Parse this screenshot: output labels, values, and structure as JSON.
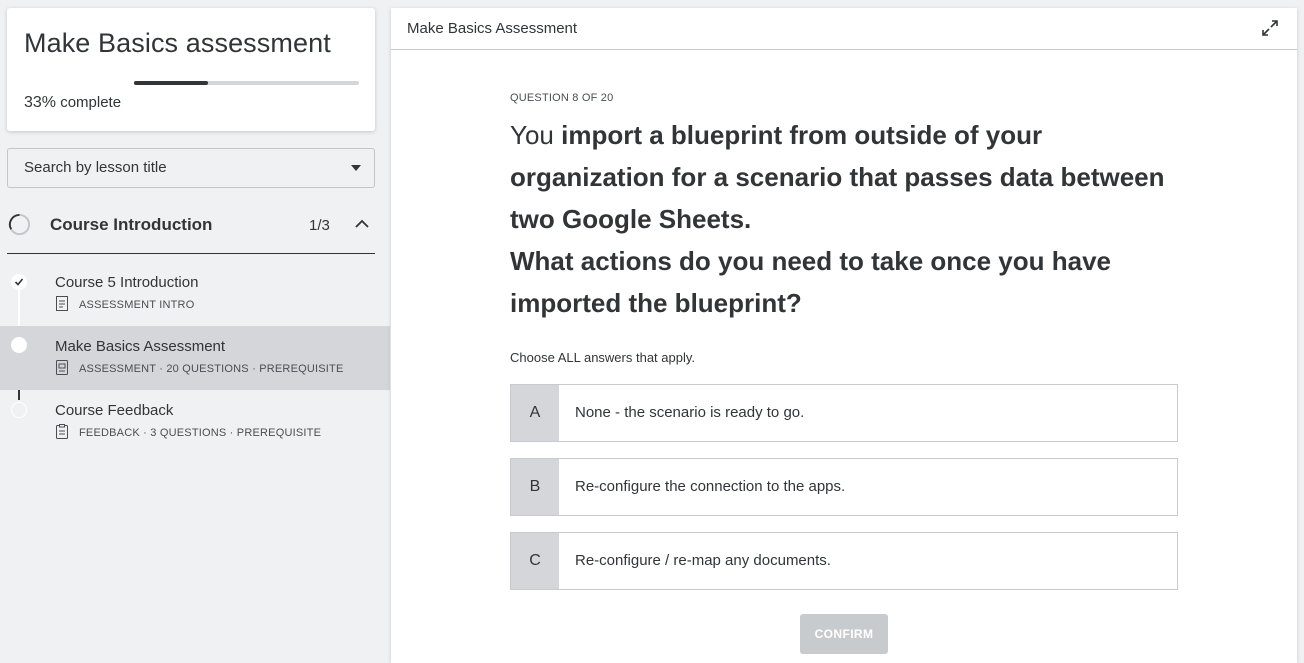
{
  "sidebar": {
    "course_title": "Make Basics assessment",
    "progress_fraction": 0.33,
    "progress_pct": "33%",
    "progress_suffix": " complete",
    "search_placeholder": "Search by lesson title",
    "section": {
      "title": "Course Introduction",
      "count": "1/3"
    },
    "lessons": [
      {
        "title": "Course 5 Introduction",
        "meta": "ASSESSMENT INTRO",
        "icon": "document-icon",
        "status": "completed"
      },
      {
        "title": "Make Basics Assessment",
        "meta": "ASSESSMENT · 20 QUESTIONS  ·  PREREQUISITE",
        "icon": "assessment-icon",
        "status": "current"
      },
      {
        "title": "Course Feedback",
        "meta": "FEEDBACK · 3 QUESTIONS  ·  PREREQUISITE",
        "icon": "clipboard-icon",
        "status": "not-started"
      }
    ]
  },
  "main": {
    "title": "Make Basics Assessment",
    "question_counter": "QUESTION 8 OF 20",
    "question": {
      "p1": "You ",
      "p2": "import",
      "p3": " a blueprint from outside of your organization for a scenario that passes data between two Google Sheets.",
      "p4": "What actions do you need to take once you have ",
      "p5": "imported",
      "p6": " the blueprint?"
    },
    "instruction": "Choose ALL answers that apply.",
    "answers": [
      {
        "letter": "A",
        "text": "None - the scenario is ready to go."
      },
      {
        "letter": "B",
        "text": "Re-configure the connection to the apps."
      },
      {
        "letter": "C",
        "text": "Re-configure / re-map any documents."
      }
    ],
    "confirm_label": "CONFIRM"
  },
  "colors": {
    "text": "#313537",
    "active_row": "#d4d6d9",
    "disabled_button": "#c8cbce",
    "background": "#f0f1f3"
  }
}
